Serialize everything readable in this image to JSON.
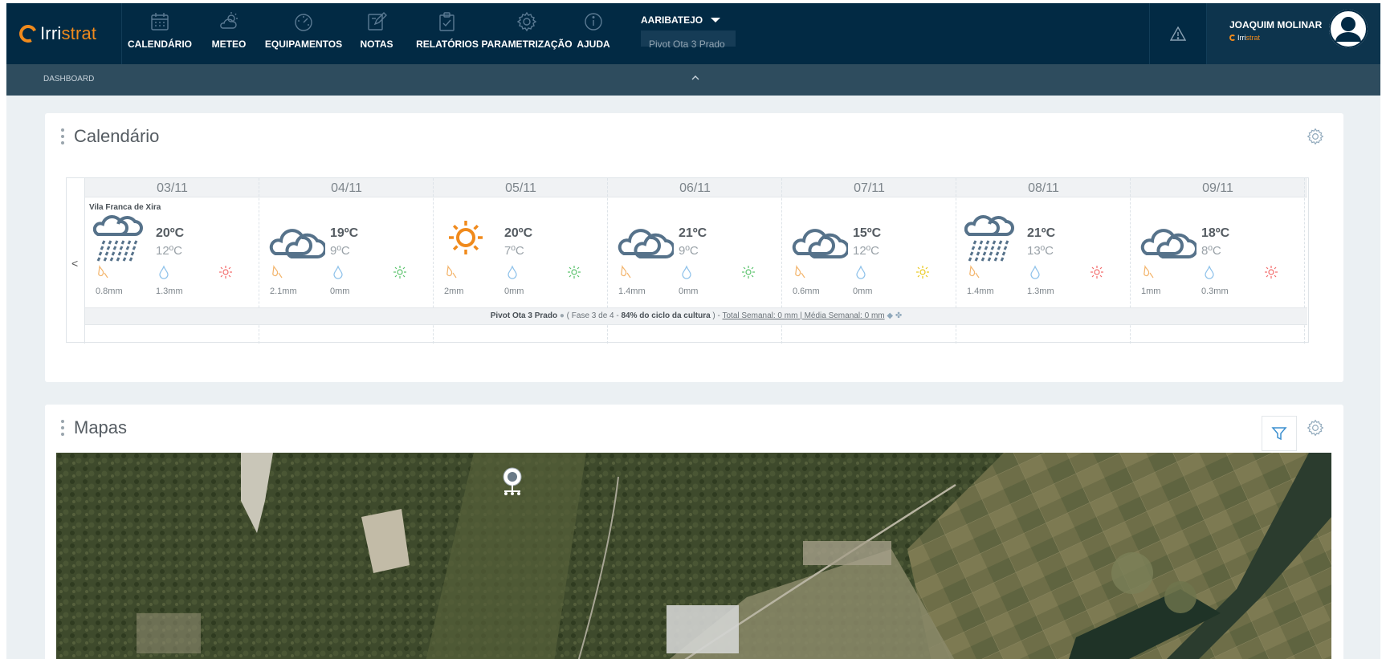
{
  "brand": {
    "name_a": "Irri",
    "name_b": "strat"
  },
  "nav": [
    {
      "id": "calendario",
      "label": "CALENDÁRIO",
      "icon": "calendar-icon"
    },
    {
      "id": "meteo",
      "label": "METEO",
      "icon": "weather-icon"
    },
    {
      "id": "equipamentos",
      "label": "EQUIPAMENTOS",
      "icon": "gauge-icon"
    },
    {
      "id": "notas",
      "label": "NOTAS",
      "icon": "edit-icon"
    },
    {
      "id": "relatorios",
      "label": "RELATÓRIOS",
      "icon": "clipboard-icon"
    },
    {
      "id": "parametrizacao",
      "label": "PARAMETRIZAÇÃO",
      "icon": "gear-icon"
    },
    {
      "id": "ajuda",
      "label": "AJUDA",
      "icon": "info-icon"
    }
  ],
  "farm": {
    "name": "AARIBATEJO",
    "sub": "Pivot Ota 3 Prado"
  },
  "user": {
    "name": "JOAQUIM MOLINAR",
    "brand_a": "Irri",
    "brand_b": "strat"
  },
  "breadcrumb": "DASHBOARD",
  "calendar": {
    "title": "Calendário",
    "prev": "<",
    "location": "Vila Franca de Xira",
    "days": [
      {
        "date": "03/11",
        "icon": "cloud-rain-icon",
        "tmax": "20ºC",
        "tmin": "12ºC",
        "rain": "0.8mm",
        "irrigation": "1.3mm",
        "status_color": "#f26b6b"
      },
      {
        "date": "04/11",
        "icon": "cloud-icon",
        "tmax": "19ºC",
        "tmin": "9ºC",
        "rain": "2.1mm",
        "irrigation": "0mm",
        "status_color": "#59c26b"
      },
      {
        "date": "05/11",
        "icon": "sun-icon",
        "tmax": "20ºC",
        "tmin": "7ºC",
        "rain": "2mm",
        "irrigation": "0mm",
        "status_color": "#59c26b"
      },
      {
        "date": "06/11",
        "icon": "cloud-icon",
        "tmax": "21ºC",
        "tmin": "9ºC",
        "rain": "1.4mm",
        "irrigation": "0mm",
        "status_color": "#59c26b"
      },
      {
        "date": "07/11",
        "icon": "cloud-icon",
        "tmax": "15ºC",
        "tmin": "12ºC",
        "rain": "0.6mm",
        "irrigation": "0mm",
        "status_color": "#e9c81c"
      },
      {
        "date": "08/11",
        "icon": "cloud-rain-icon",
        "tmax": "21ºC",
        "tmin": "13ºC",
        "rain": "1.4mm",
        "irrigation": "1.3mm",
        "status_color": "#f26b6b"
      },
      {
        "date": "09/11",
        "icon": "cloud-icon",
        "tmax": "18ºC",
        "tmin": "8ºC",
        "rain": "1mm",
        "irrigation": "0.3mm",
        "status_color": "#f26b6b"
      }
    ],
    "pivot": {
      "name": "Pivot Ota 3 Prado",
      "phase_text": " ( Fase 3 de 4 - ",
      "cycle": "84% do ciclo da cultura",
      "after": " ) - ",
      "totals": "Total Semanal: 0 mm | Média Semanal: 0 mm"
    }
  },
  "maps": {
    "title": "Mapas"
  },
  "colors": {
    "nav_bg": "#022a44",
    "subbar_bg": "#2e4c5e",
    "accent": "#f08a1c",
    "icon_blue": "#5b7a93"
  }
}
